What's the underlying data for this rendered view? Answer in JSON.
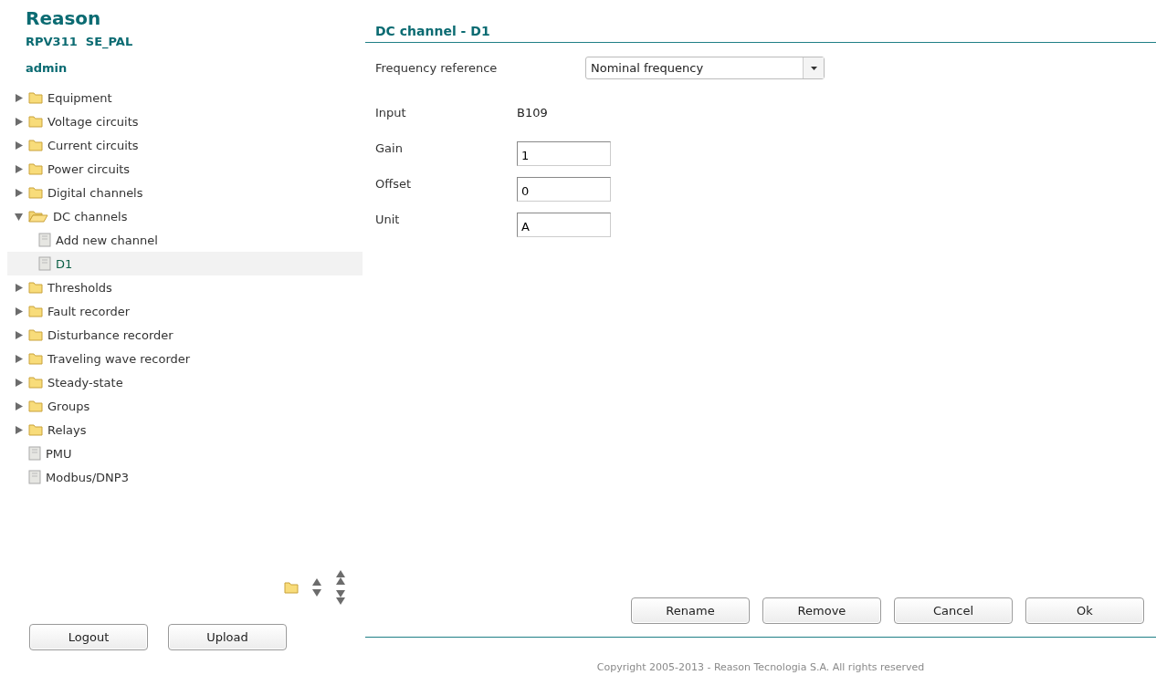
{
  "brand": {
    "title": "Reason",
    "device": "RPV311  SE_PAL",
    "user": "admin"
  },
  "tree": [
    {
      "label": "Equipment",
      "kind": "folder",
      "expanded": false,
      "selected": false
    },
    {
      "label": "Voltage circuits",
      "kind": "folder",
      "expanded": false,
      "selected": false
    },
    {
      "label": "Current circuits",
      "kind": "folder",
      "expanded": false,
      "selected": false
    },
    {
      "label": "Power circuits",
      "kind": "folder",
      "expanded": false,
      "selected": false
    },
    {
      "label": "Digital channels",
      "kind": "folder",
      "expanded": false,
      "selected": false
    },
    {
      "label": "DC channels",
      "kind": "folder",
      "expanded": true,
      "selected": false,
      "children": [
        {
          "label": "Add new channel",
          "kind": "file",
          "selected": false
        },
        {
          "label": "D1",
          "kind": "file",
          "selected": true
        }
      ]
    },
    {
      "label": "Thresholds",
      "kind": "folder",
      "expanded": false,
      "selected": false
    },
    {
      "label": "Fault recorder",
      "kind": "folder",
      "expanded": false,
      "selected": false
    },
    {
      "label": "Disturbance recorder",
      "kind": "folder",
      "expanded": false,
      "selected": false
    },
    {
      "label": "Traveling wave recorder",
      "kind": "folder",
      "expanded": false,
      "selected": false
    },
    {
      "label": "Steady-state",
      "kind": "folder",
      "expanded": false,
      "selected": false
    },
    {
      "label": "Groups",
      "kind": "folder",
      "expanded": false,
      "selected": false
    },
    {
      "label": "Relays",
      "kind": "folder",
      "expanded": false,
      "selected": false
    },
    {
      "label": "PMU",
      "kind": "file",
      "selected": false
    },
    {
      "label": "Modbus/DNP3",
      "kind": "file",
      "selected": false
    }
  ],
  "sidebar_buttons": [
    "Logout",
    "Upload"
  ],
  "panel": {
    "title": "DC channel - D1",
    "frequency": {
      "label": "Frequency reference",
      "value": "Nominal frequency"
    },
    "fields": [
      {
        "label": "Input",
        "kind": "text",
        "value": "B109"
      },
      {
        "label": "Gain",
        "kind": "input",
        "value": "1"
      },
      {
        "label": "Offset",
        "kind": "input",
        "value": "0"
      },
      {
        "label": "Unit",
        "kind": "input",
        "value": "A"
      }
    ],
    "buttons": [
      "Rename",
      "Remove",
      "Cancel",
      "Ok"
    ]
  },
  "footer": "Copyright 2005-2013 - Reason Tecnologia S.A. All rights reserved"
}
